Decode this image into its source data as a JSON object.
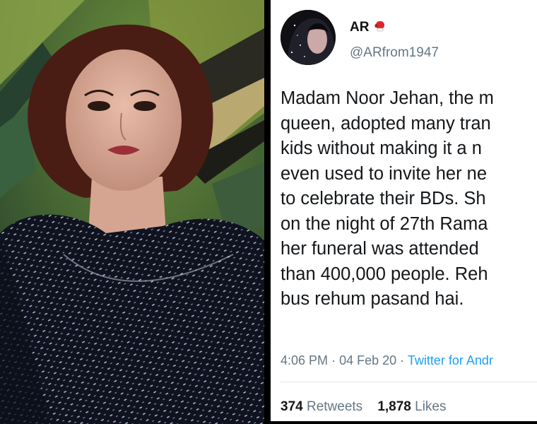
{
  "tweet": {
    "display_name": "AR",
    "name_emoji": "boxing-glove",
    "handle": "@ARfrom1947",
    "text": "Madam Noor Jehan, the m\nqueen, adopted many tran\nkids without making it a n\neven used to invite her ne\nto celebrate their BDs. Sh\non the night of 27th Rama\nher funeral was attended\nthan 400,000 people. Reh\nbus rehum pasand hai.",
    "time": "4:06 PM",
    "date": "04 Feb 20",
    "source": "Twitter for Andr",
    "retweet_count": "374",
    "retweet_label": "Retweets",
    "like_count": "1,878",
    "like_label": "Likes"
  },
  "colors": {
    "link": "#1da1f2",
    "secondary": "#657786",
    "glove": "#d9262b"
  }
}
